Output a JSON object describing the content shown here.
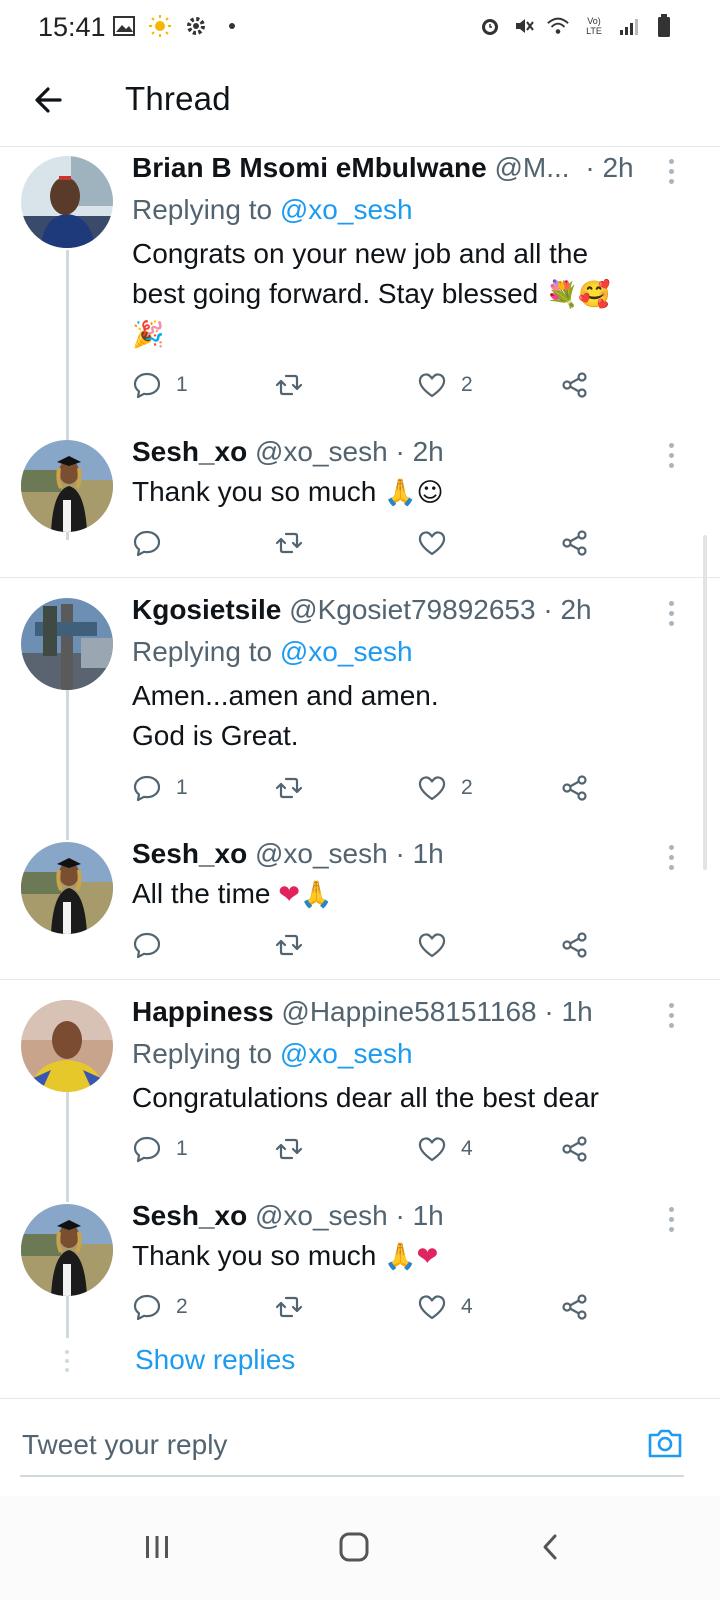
{
  "status_bar": {
    "time": "15:41",
    "left_icons": [
      "image-icon",
      "sun-icon",
      "settings-icon",
      "dot-icon"
    ],
    "right_icons": [
      "alarm-icon",
      "mute-icon",
      "wifi-icon",
      "volte-icon",
      "signal-icon",
      "battery-icon"
    ],
    "volte_text": "Vo) LTE"
  },
  "header": {
    "title": "Thread",
    "back_icon": "arrow-left-icon"
  },
  "tweets": [
    {
      "name": "Brian B Msomi eMbulwane",
      "handle": "@M...",
      "dot": "·",
      "time": "2h",
      "replying_prefix": "Replying to",
      "replying_to": "@xo_sesh",
      "text_lines": [
        "Congrats on your new job and all the",
        "best going forward. Stay blessed"
      ],
      "emoji_inline": "💐🥰",
      "emoji_line": "🎉",
      "replies": "1",
      "retweets": "",
      "likes": "2"
    },
    {
      "name": "Sesh_xo",
      "handle": "@xo_sesh",
      "dot": "·",
      "time": "2h",
      "text": "Thank you so much",
      "emoji": "🙏☺",
      "replies": "",
      "retweets": "",
      "likes": ""
    },
    {
      "name": "Kgosietsile",
      "handle": "@Kgosiet79892653",
      "dot": "·",
      "time": "2h",
      "replying_prefix": "Replying to",
      "replying_to": "@xo_sesh",
      "text_lines": [
        "Amen...amen and amen.",
        "God is Great."
      ],
      "replies": "1",
      "retweets": "",
      "likes": "2"
    },
    {
      "name": "Sesh_xo",
      "handle": "@xo_sesh",
      "dot": "·",
      "time": "1h",
      "text": "All the time",
      "emoji": "❤🙏",
      "replies": "",
      "retweets": "",
      "likes": ""
    },
    {
      "name": "Happiness",
      "handle": "@Happine58151168",
      "dot": "·",
      "time": "1h",
      "replying_prefix": "Replying to",
      "replying_to": "@xo_sesh",
      "text": "Congratulations dear all the best dear",
      "replies": "1",
      "retweets": "",
      "likes": "4"
    },
    {
      "name": "Sesh_xo",
      "handle": "@xo_sesh",
      "dot": "·",
      "time": "1h",
      "text": "Thank you so much",
      "emoji": "🙏❤",
      "replies": "2",
      "retweets": "",
      "likes": "4"
    }
  ],
  "show_replies": "Show replies",
  "composer": {
    "placeholder": "Tweet your reply",
    "camera_icon": "camera-icon"
  },
  "navbar": {
    "icons": [
      "recent-apps-icon",
      "home-icon",
      "back-icon"
    ]
  },
  "colors": {
    "accent": "#1d9bf0",
    "secondary_text": "#536471",
    "divider": "#e6e9ec",
    "heart_red": "#e0245e"
  }
}
